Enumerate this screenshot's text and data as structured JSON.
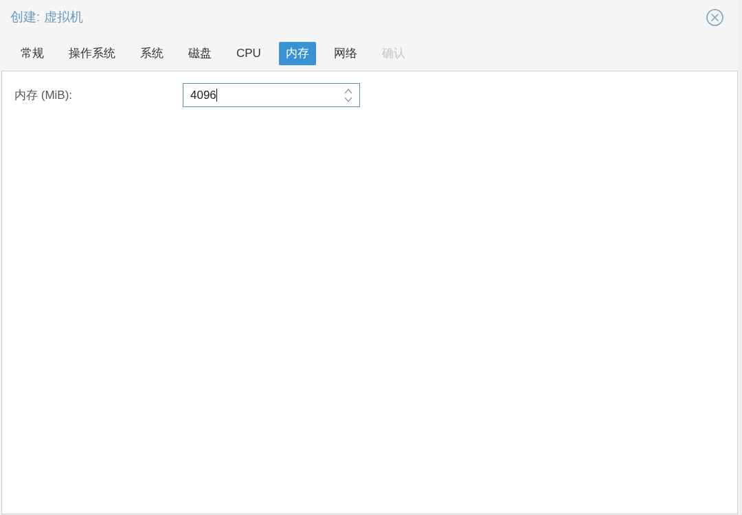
{
  "window": {
    "title": "创建: 虚拟机"
  },
  "tabs": [
    {
      "label": "常规",
      "selected": false,
      "disabled": false
    },
    {
      "label": "操作系统",
      "selected": false,
      "disabled": false
    },
    {
      "label": "系统",
      "selected": false,
      "disabled": false
    },
    {
      "label": "磁盘",
      "selected": false,
      "disabled": false
    },
    {
      "label": "CPU",
      "selected": false,
      "disabled": false
    },
    {
      "label": "内存",
      "selected": true,
      "disabled": false
    },
    {
      "label": "网络",
      "selected": false,
      "disabled": false
    },
    {
      "label": "确认",
      "selected": false,
      "disabled": true
    }
  ],
  "form": {
    "fields": [
      {
        "label": "内存 (MiB):",
        "value": "4096",
        "focused": true
      }
    ]
  }
}
